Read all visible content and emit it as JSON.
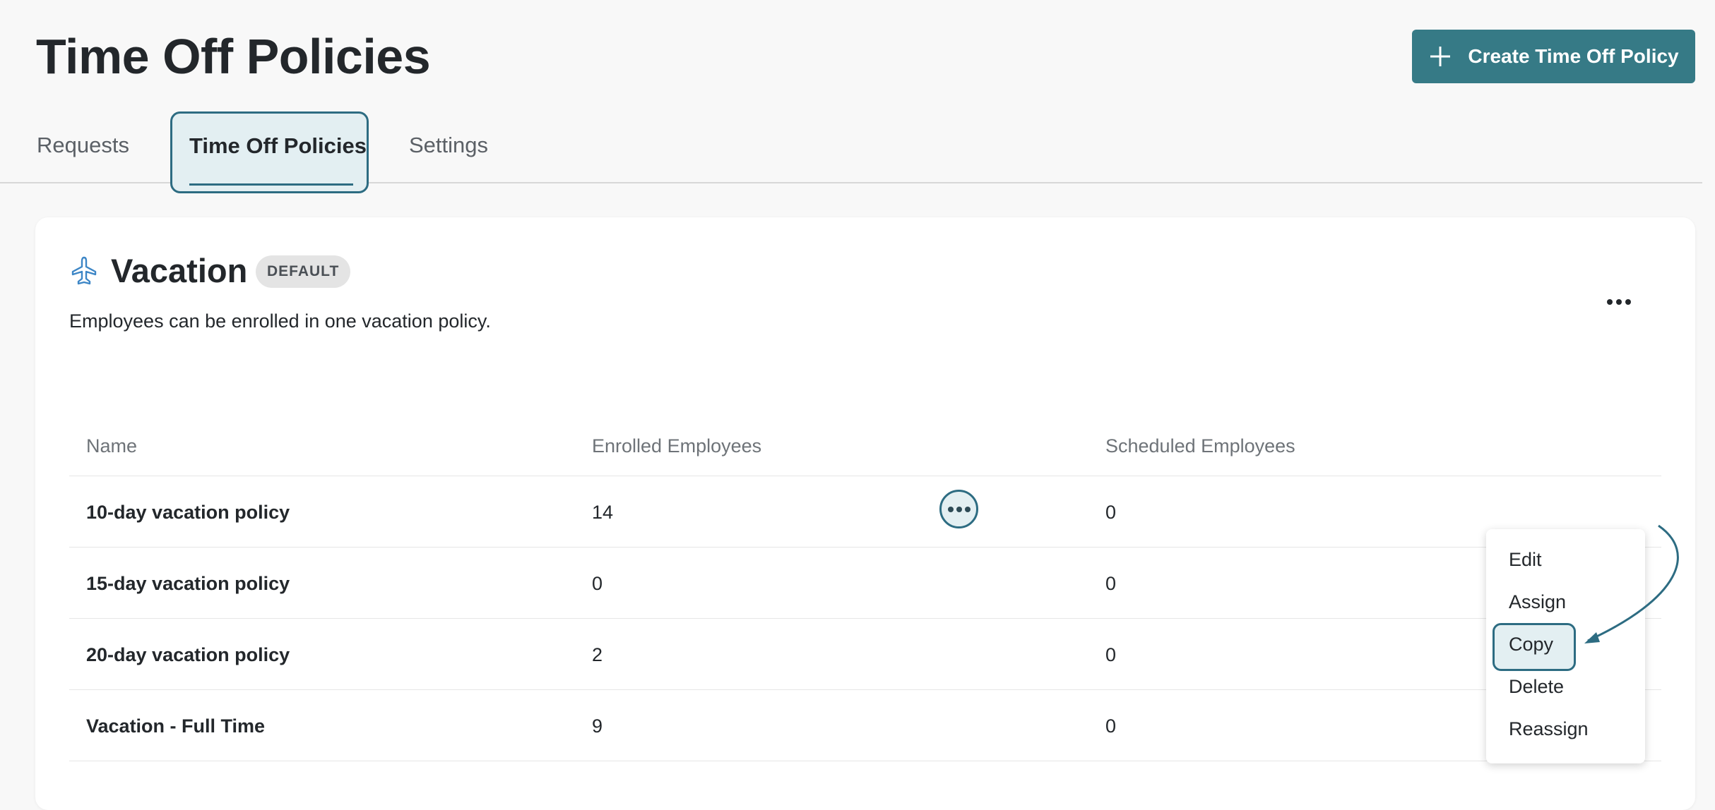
{
  "header": {
    "title": "Time Off Policies",
    "create_button_label": "Create Time Off Policy"
  },
  "tabs": [
    {
      "label": "Requests",
      "active": false
    },
    {
      "label": "Time Off Policies",
      "active": true
    },
    {
      "label": "Settings",
      "active": false
    }
  ],
  "policy_card": {
    "icon": "airplane-icon",
    "title": "Vacation",
    "badge": "DEFAULT",
    "description": "Employees can be enrolled in one vacation policy.",
    "columns": [
      "Name",
      "Enrolled Employees",
      "Scheduled Employees"
    ],
    "rows": [
      {
        "name": "10-day vacation policy",
        "enrolled": "14",
        "scheduled": "0"
      },
      {
        "name": "15-day vacation policy",
        "enrolled": "0",
        "scheduled": "0"
      },
      {
        "name": "20-day vacation policy",
        "enrolled": "2",
        "scheduled": "0"
      },
      {
        "name": "Vacation - Full Time",
        "enrolled": "9",
        "scheduled": "0"
      }
    ]
  },
  "row_menu": {
    "items": [
      "Edit",
      "Assign",
      "Copy",
      "Delete",
      "Reassign"
    ],
    "highlighted": "Copy"
  },
  "colors": {
    "accent": "#367a86",
    "highlight_border": "#2d6c82",
    "highlight_fill": "#e3eff2"
  }
}
